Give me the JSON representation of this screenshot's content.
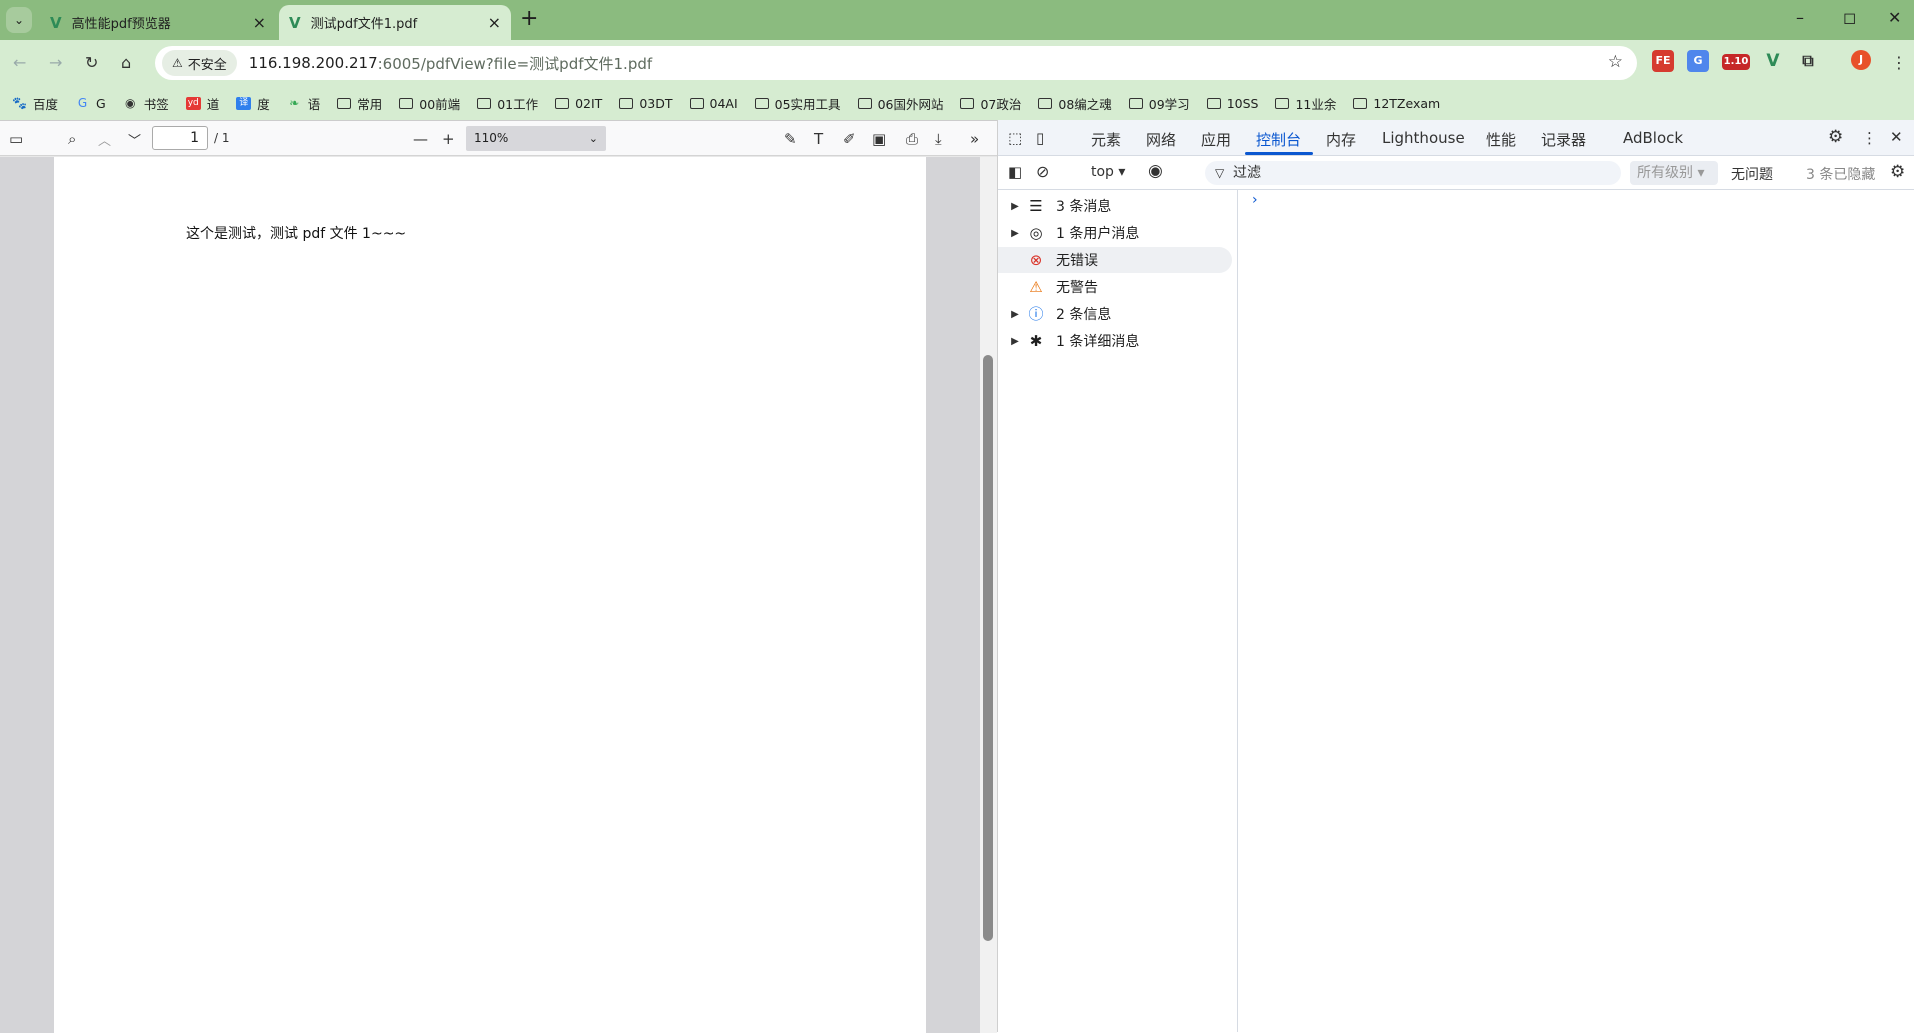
{
  "browser": {
    "tabs": [
      {
        "title": "高性能pdf预览器",
        "active": false
      },
      {
        "title": "测试pdf文件1.pdf",
        "active": true
      }
    ],
    "new_tab": "+",
    "window_controls": [
      "–",
      "◻",
      "✕"
    ],
    "security_chip": "不安全",
    "url_host": "116.198.200.217",
    "url_rest": ":6005/pdfView?file=测试pdf文件1.pdf",
    "ext_badge": "1.10",
    "profile_initial": "J",
    "bookmarks": [
      {
        "label": "百度",
        "icon": "baidu-icon"
      },
      {
        "label": "G",
        "icon": "google-icon"
      },
      {
        "label": "书签",
        "icon": "globe-icon"
      },
      {
        "label": "道",
        "icon": "youdao-icon"
      },
      {
        "label": "度",
        "icon": "translate-icon"
      },
      {
        "label": "语",
        "icon": "leaf-icon"
      },
      {
        "label": "常用",
        "icon": "folder-icon"
      },
      {
        "label": "00前端",
        "icon": "folder-icon"
      },
      {
        "label": "01工作",
        "icon": "folder-icon"
      },
      {
        "label": "02IT",
        "icon": "folder-icon"
      },
      {
        "label": "03DT",
        "icon": "folder-icon"
      },
      {
        "label": "04AI",
        "icon": "folder-icon"
      },
      {
        "label": "05实用工具",
        "icon": "folder-icon"
      },
      {
        "label": "06国外网站",
        "icon": "folder-icon"
      },
      {
        "label": "07政治",
        "icon": "folder-icon"
      },
      {
        "label": "08编之魂",
        "icon": "folder-icon"
      },
      {
        "label": "09学习",
        "icon": "folder-icon"
      },
      {
        "label": "10SS",
        "icon": "folder-icon"
      },
      {
        "label": "11业余",
        "icon": "folder-icon"
      },
      {
        "label": "12TZexam",
        "icon": "folder-icon"
      }
    ]
  },
  "pdf": {
    "page_number": "1",
    "page_count": "/ 1",
    "zoom": "110%",
    "page_text": "这个是测试，测试 pdf 文件 1~~~"
  },
  "devtools": {
    "tabs": [
      "元素",
      "网络",
      "应用",
      "控制台",
      "内存",
      "Lighthouse",
      "性能",
      "记录器",
      "AdBlock"
    ],
    "active_tab": "控制台",
    "context": "top ▾",
    "filter_placeholder": "过滤",
    "levels": "所有级别 ▾",
    "issues": "无问题",
    "hidden": "3 条已隐藏",
    "sidebar": [
      {
        "label": "3 条消息",
        "icon": "list-icon",
        "expandable": true
      },
      {
        "label": "1 条用户消息",
        "icon": "user-icon",
        "expandable": true
      },
      {
        "label": "无错误",
        "icon": "error-icon",
        "expandable": false
      },
      {
        "label": "无警告",
        "icon": "warning-icon",
        "expandable": false
      },
      {
        "label": "2 条信息",
        "icon": "info-icon",
        "expandable": true
      },
      {
        "label": "1 条详细消息",
        "icon": "bug-icon",
        "expandable": true
      }
    ],
    "prompt": "›"
  },
  "colors": {
    "chrome_frame": "#8bbb7f",
    "chrome_toolbar": "#d6ecd1",
    "devtools_accent": "#0b57d0",
    "error": "#d93025",
    "warning": "#e8710a",
    "info": "#1a73e8"
  }
}
